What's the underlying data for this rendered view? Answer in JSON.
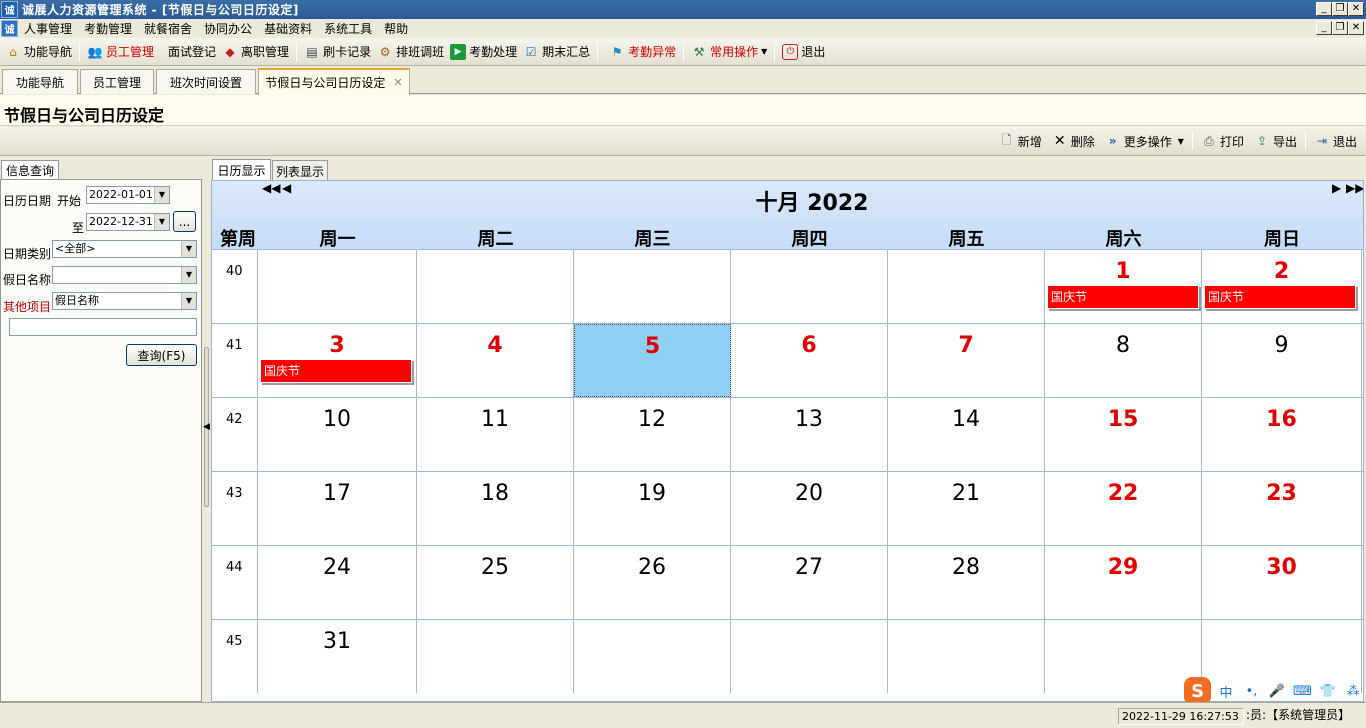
{
  "window": {
    "logo_text": "诚",
    "title": "诚展人力资源管理系统 - [节假日与公司日历设定]",
    "min": "_",
    "restore": "❐",
    "close": "✕"
  },
  "menu": [
    "人事管理",
    "考勤管理",
    "就餐宿舍",
    "协同办公",
    "基础资料",
    "系统工具",
    "帮助"
  ],
  "toolbar": {
    "items": [
      {
        "label": "功能导航",
        "icon": "home-icon",
        "red": false
      },
      {
        "label": "员工管理",
        "icon": "users-icon",
        "red": true
      },
      {
        "label": "面试登记",
        "icon": "",
        "red": false
      },
      {
        "label": "离职管理",
        "icon": "leave-icon",
        "red": false
      },
      {
        "label": "刷卡记录",
        "icon": "card-icon",
        "red": false
      },
      {
        "label": "排班调班",
        "icon": "schedule-icon",
        "red": false
      },
      {
        "label": "考勤处理",
        "icon": "play-icon",
        "red": false
      },
      {
        "label": "期末汇总",
        "icon": "check-icon",
        "red": false
      },
      {
        "label": "考勤异常",
        "icon": "alert-icon",
        "red": true
      },
      {
        "label": "常用操作",
        "icon": "tools-icon",
        "red": true
      },
      {
        "label": "退出",
        "icon": "exit-icon",
        "red": false
      }
    ]
  },
  "tabs": [
    {
      "label": "功能导航"
    },
    {
      "label": "员工管理"
    },
    {
      "label": "班次时间设置"
    },
    {
      "label": "节假日与公司日历设定",
      "close": "✕"
    }
  ],
  "page": {
    "title": "节假日与公司日历设定"
  },
  "actions": {
    "add": "新增",
    "delete": "删除",
    "more": "更多操作",
    "print": "打印",
    "export": "导出",
    "exit": "退出"
  },
  "left": {
    "tab": "信息查询",
    "date_label": "日历日期",
    "start_label": "开始",
    "start_value": "2022-01-01",
    "to_label": "至",
    "end_value": "2022-12-31",
    "ellipsis": "...",
    "type_label": "日期类别",
    "type_value": "<全部>",
    "name_label": "假日名称",
    "name_value": "",
    "other_label": "其他项目",
    "other_value": "假日名称",
    "other_text": "",
    "query_button": "查询(F5)"
  },
  "right": {
    "tab_calendar": "日历显示",
    "tab_list": "列表显示"
  },
  "calendar": {
    "month_title": "十月 2022",
    "nav_prev2": "◀◀",
    "nav_prev": "◀",
    "nav_next": "▶",
    "nav_next2": "▶▶",
    "week_header": "第周",
    "days": [
      "周一",
      "周二",
      "周三",
      "周四",
      "周五",
      "周六",
      "周日"
    ],
    "rows": [
      {
        "week": "40",
        "cells": [
          {
            "day": "",
            "red": false
          },
          {
            "day": "",
            "red": false
          },
          {
            "day": "",
            "red": false
          },
          {
            "day": "",
            "red": false
          },
          {
            "day": "",
            "red": false
          },
          {
            "day": "1",
            "red": true,
            "event": "国庆节"
          },
          {
            "day": "2",
            "red": true,
            "event": "国庆节"
          }
        ]
      },
      {
        "week": "41",
        "cells": [
          {
            "day": "3",
            "red": true,
            "event": "国庆节"
          },
          {
            "day": "4",
            "red": true
          },
          {
            "day": "5",
            "red": true,
            "selected": true
          },
          {
            "day": "6",
            "red": true
          },
          {
            "day": "7",
            "red": true
          },
          {
            "day": "8",
            "red": false
          },
          {
            "day": "9",
            "red": false
          }
        ]
      },
      {
        "week": "42",
        "cells": [
          {
            "day": "10"
          },
          {
            "day": "11"
          },
          {
            "day": "12"
          },
          {
            "day": "13"
          },
          {
            "day": "14"
          },
          {
            "day": "15",
            "red": true
          },
          {
            "day": "16",
            "red": true
          }
        ]
      },
      {
        "week": "43",
        "cells": [
          {
            "day": "17"
          },
          {
            "day": "18"
          },
          {
            "day": "19"
          },
          {
            "day": "20"
          },
          {
            "day": "21"
          },
          {
            "day": "22",
            "red": true
          },
          {
            "day": "23",
            "red": true
          }
        ]
      },
      {
        "week": "44",
        "cells": [
          {
            "day": "24"
          },
          {
            "day": "25"
          },
          {
            "day": "26"
          },
          {
            "day": "27"
          },
          {
            "day": "28"
          },
          {
            "day": "29",
            "red": true
          },
          {
            "day": "30",
            "red": true
          }
        ]
      },
      {
        "week": "45",
        "cells": [
          {
            "day": "31"
          },
          {
            "day": ""
          },
          {
            "day": ""
          },
          {
            "day": ""
          },
          {
            "day": ""
          },
          {
            "day": ""
          },
          {
            "day": ""
          }
        ]
      }
    ]
  },
  "status": {
    "datetime": "2022-11-29 16:27:53",
    "user": ":员:【系统管理员】"
  },
  "ime": {
    "logo": "S",
    "items": [
      "中",
      "•,",
      "🎤",
      "⌨",
      "👕",
      "⁂"
    ]
  },
  "colors": {
    "holiday_red": "#ff0000",
    "weekend_text_red": "#e00000",
    "selected_cell": "#8fcff3",
    "calendar_header": "#c6dcf7"
  }
}
